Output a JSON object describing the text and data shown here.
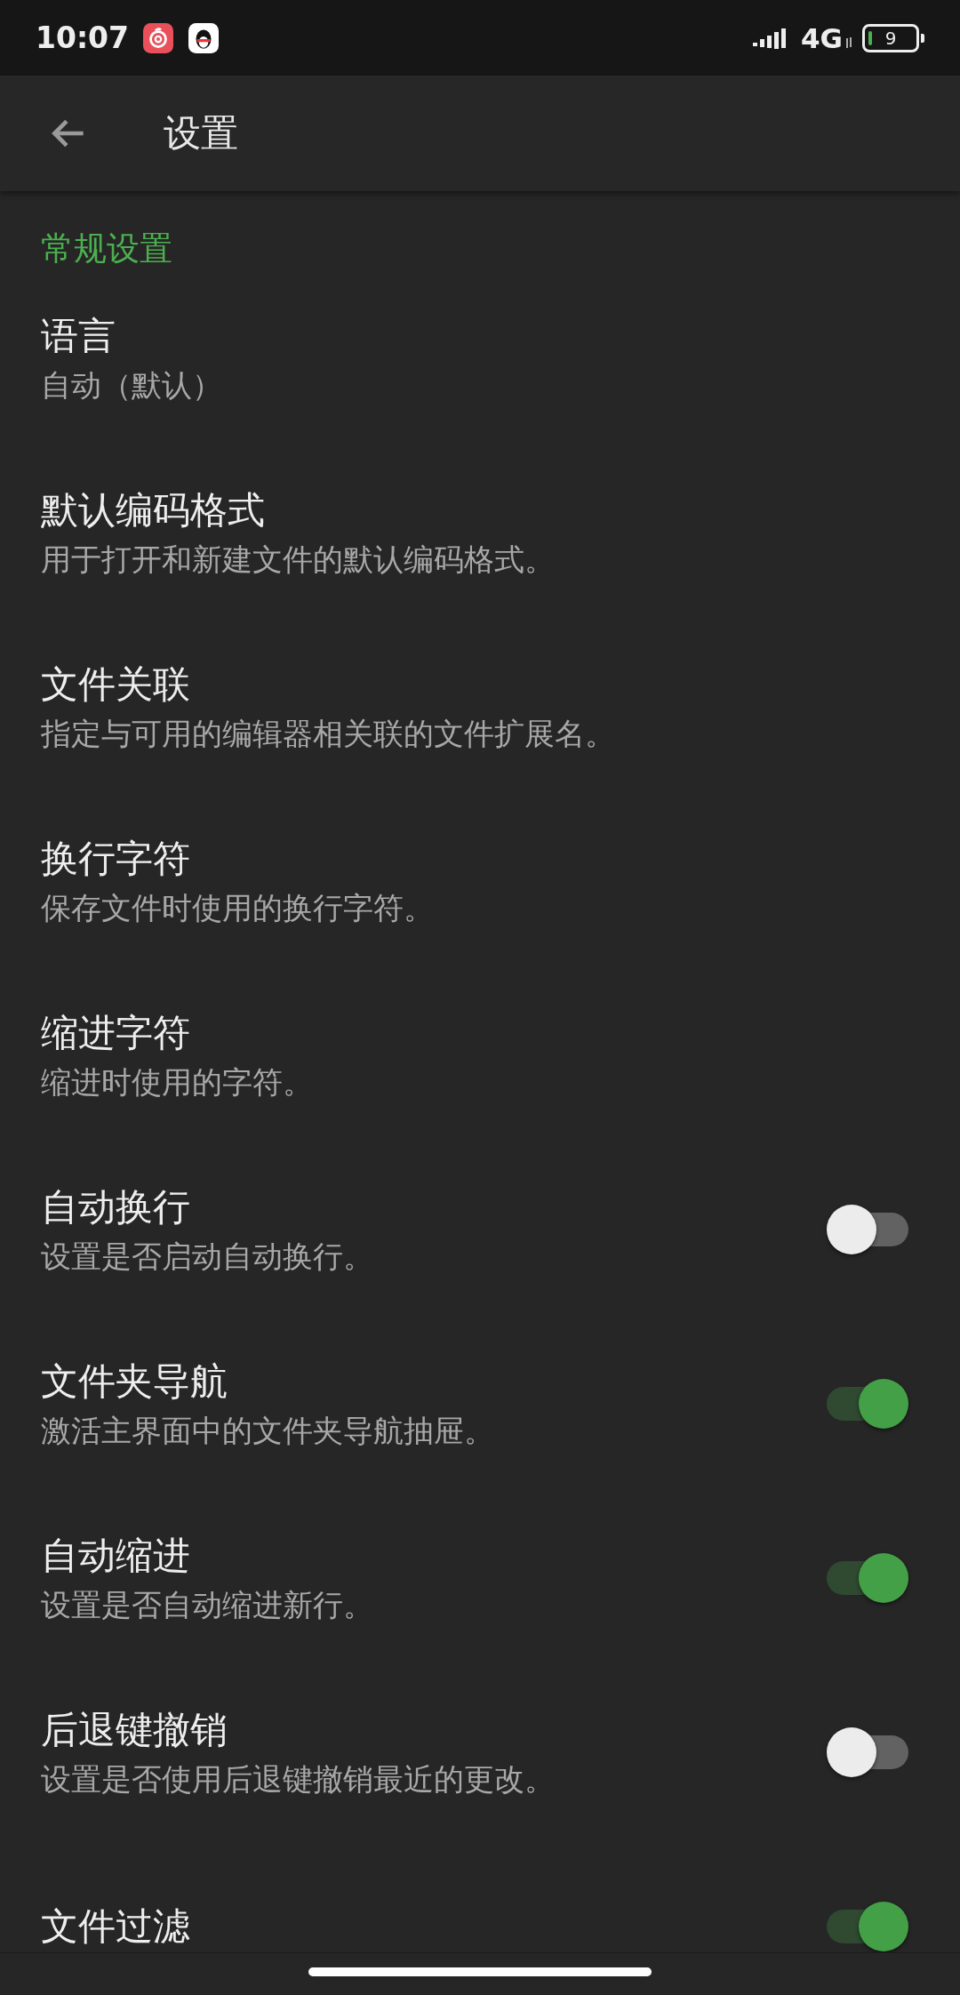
{
  "status_bar": {
    "time": "10:07",
    "network": "4G",
    "battery": "9"
  },
  "toolbar": {
    "title": "设置"
  },
  "section": {
    "title": "常规设置"
  },
  "items": [
    {
      "kind": "plain",
      "title": "语言",
      "subtitle": "自动（默认）"
    },
    {
      "kind": "plain",
      "title": "默认编码格式",
      "subtitle": "用于打开和新建文件的默认编码格式。"
    },
    {
      "kind": "plain",
      "title": "文件关联",
      "subtitle": "指定与可用的编辑器相关联的文件扩展名。"
    },
    {
      "kind": "plain",
      "title": "换行字符",
      "subtitle": "保存文件时使用的换行字符。"
    },
    {
      "kind": "plain",
      "title": "缩进字符",
      "subtitle": "缩进时使用的字符。"
    },
    {
      "kind": "toggle",
      "title": "自动换行",
      "subtitle": "设置是否启动自动换行。",
      "on": false
    },
    {
      "kind": "toggle",
      "title": "文件夹导航",
      "subtitle": "激活主界面中的文件夹导航抽屉。",
      "on": true
    },
    {
      "kind": "toggle",
      "title": "自动缩进",
      "subtitle": "设置是否自动缩进新行。",
      "on": true
    },
    {
      "kind": "toggle",
      "title": "后退键撤销",
      "subtitle": "设置是否使用后退键撤销最近的更改。",
      "on": false
    },
    {
      "kind": "toggle",
      "title": "文件过滤",
      "on": true
    }
  ]
}
